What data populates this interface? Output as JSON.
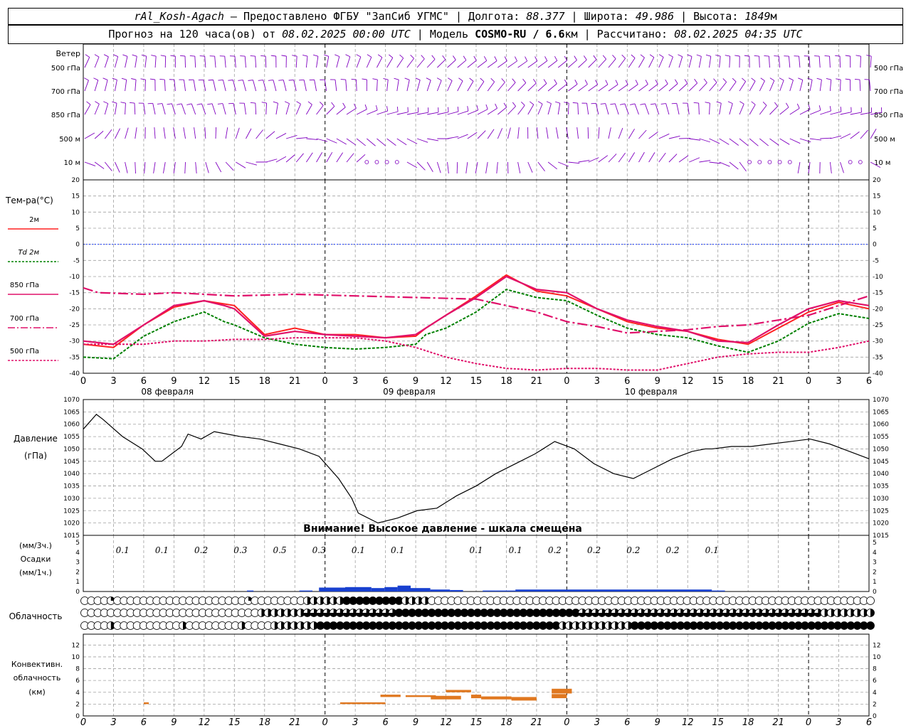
{
  "header": {
    "station": "rAl_Kosh-Agach",
    "sep1": " – ",
    "provider": "Предоставлено ФГБУ \"ЗапСиб УГМС\"",
    "lon_label": " | Долгота: ",
    "lon": "88.377",
    "lat_label": " | Широта: ",
    "lat": "49.986",
    "alt_label": " | Высота: ",
    "alt": "1849",
    "alt_unit": "м",
    "forecast_prefix": "Прогноз на 120 часа(ов) от ",
    "forecast_start": "08.02.2025 00:00 UTC",
    "model_label": "  | Модель ",
    "model": "COSMO-RU / 6.6",
    "model_unit": "км",
    "calc_label": " | Рассчитано: ",
    "calc": "08.02.2025 04:35 UTC"
  },
  "colors": {
    "t2m": "#ff2020",
    "td2m": "#008000",
    "t850": "#e0106a",
    "t700": "#e0106a",
    "t500": "#e0106a",
    "wind": "#8000c0",
    "pressure": "#000000",
    "precip": "#1840d0",
    "conv": "#e07820",
    "zero_line": "#2040ff"
  },
  "wind_panel": {
    "title": "Ветер",
    "levels": [
      "500 гПа",
      "700 гПа",
      "850 гПа",
      "500 м",
      "10 м"
    ]
  },
  "temp_panel": {
    "title": "Тем-ра(°C)",
    "legend": [
      {
        "label": "2м",
        "style": "solid",
        "key": "t2m"
      },
      {
        "label": "Td 2м",
        "style": "dotted",
        "key": "td2m"
      },
      {
        "label": "850 гПа",
        "style": "solid",
        "key": "t850"
      },
      {
        "label": "700 гПа",
        "style": "dashdot",
        "key": "t700"
      },
      {
        "label": "500 гПа",
        "style": "dotted",
        "key": "t500"
      }
    ],
    "yticks": [
      20,
      15,
      10,
      5,
      0,
      -5,
      -10,
      -15,
      -20,
      -25,
      -30,
      -35,
      -40
    ]
  },
  "x_axis": {
    "tick_labels": [
      "0",
      "3",
      "6",
      "9",
      "12",
      "15",
      "18",
      "21",
      "0",
      "3",
      "6",
      "9",
      "12",
      "15",
      "18",
      "21",
      "0",
      "3",
      "6",
      "9",
      "12",
      "15",
      "18",
      "21",
      "0",
      "3",
      "6"
    ],
    "dates": [
      "08 февраля",
      "09 февраля",
      "10 февраля"
    ]
  },
  "pressure_panel": {
    "title1": "Давление",
    "title2": "(гПа)",
    "yticks": [
      1070,
      1065,
      1060,
      1055,
      1050,
      1045,
      1040,
      1035,
      1030,
      1025,
      1020,
      1015
    ],
    "warning": "Внимание! Высокое давление - шкала смещена"
  },
  "precip_panel": {
    "title1": "(мм/3ч.)",
    "title2": "Осадки",
    "title3": "(мм/1ч.)",
    "yticks": [
      5,
      4,
      3,
      2,
      1,
      0
    ],
    "labels": [
      "0.1",
      "0.1",
      "0.2",
      "0.3",
      "0.5",
      "0.3",
      "0.1",
      "0.1",
      "0.1",
      "0.1",
      "0.2",
      "0.2",
      "0.2",
      "0.2",
      "0.1"
    ],
    "label_hours": [
      6,
      12,
      18,
      24,
      30,
      36,
      42,
      48,
      60,
      66,
      72,
      78,
      84,
      90,
      96
    ]
  },
  "cloud_panel": {
    "title": "Облачность"
  },
  "conv_panel": {
    "title1": "Конвективн.",
    "title2": "облачность",
    "title3": "(км)",
    "yticks": [
      12,
      10,
      8,
      6,
      4,
      2,
      0
    ]
  },
  "chart_data": [
    {
      "type": "line",
      "title": "Тем-ра(°C)",
      "ylim": [
        -40,
        20
      ],
      "x_hours": [
        0,
        3,
        6,
        9,
        12,
        14,
        15,
        18,
        21,
        24,
        27,
        30,
        33,
        34,
        36,
        39,
        42,
        45,
        48,
        51,
        54,
        57,
        60,
        63,
        66,
        69,
        72,
        75,
        78
      ],
      "series": [
        {
          "name": "2м",
          "values": [
            -31,
            -32,
            -25,
            -19.5,
            -17.5,
            -18.5,
            -19,
            -28,
            -26,
            -28,
            -28,
            -29,
            -28.5,
            -26,
            -22,
            -16,
            -9.5,
            -14.5,
            -16,
            -20,
            -24,
            -26,
            -27,
            -29.5,
            -31,
            -26,
            -21,
            -18,
            -20
          ]
        },
        {
          "name": "Td 2м",
          "values": [
            -35,
            -35.5,
            -28.5,
            -24,
            -21,
            -24,
            -25,
            -29,
            -31,
            -32,
            -32.5,
            -32,
            -31,
            -28,
            -26,
            -21,
            -14,
            -16.5,
            -17.5,
            -22,
            -26,
            -28,
            -29,
            -31.5,
            -33.5,
            -30,
            -24.5,
            -21.5,
            -23
          ]
        }
      ]
    },
    {
      "type": "line",
      "title": "Давление (гПа)",
      "ylim": [
        1015,
        1070
      ],
      "x_hours": [
        0,
        2,
        3,
        6,
        9,
        11,
        12,
        15,
        16,
        18,
        20,
        22,
        24,
        27,
        30,
        33,
        36,
        39,
        41,
        42,
        45,
        48,
        51,
        54,
        57,
        60,
        63,
        66,
        69,
        72,
        75,
        78,
        81,
        84,
        87,
        90,
        93,
        95,
        96,
        99,
        102,
        105,
        108,
        111,
        114,
        117,
        120
      ],
      "values": [
        1058,
        1064,
        1062,
        1055,
        1050,
        1045,
        1045,
        1051,
        1056,
        1054,
        1057,
        1056,
        1055,
        1054,
        1052,
        1050,
        1047,
        1038,
        1030,
        1024,
        1020,
        1022,
        1025,
        1026,
        1031,
        1035,
        1040,
        1044,
        1048,
        1053,
        1050,
        1044,
        1040,
        1038,
        1042,
        1046,
        1049,
        1050,
        1050,
        1051,
        1051,
        1052,
        1053,
        1054,
        1052,
        1049,
        1046
      ]
    }
  ]
}
